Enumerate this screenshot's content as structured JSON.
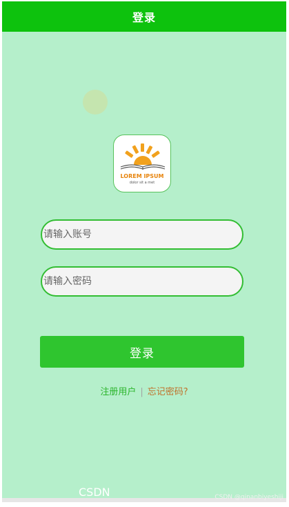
{
  "header": {
    "title": "登录"
  },
  "logo": {
    "text_main": "LOREM IPSUM",
    "text_sub": "dolor sit a met"
  },
  "form": {
    "username_placeholder": "请输入账号",
    "password_placeholder": "请输入密码",
    "login_button_label": "登录"
  },
  "links": {
    "register": "注册用户",
    "separator": "|",
    "forgot": "忘记密码?"
  },
  "watermark": {
    "brand": "CSDN",
    "user": "CSDN @qinanbiyeshiji"
  },
  "colors": {
    "header_bg": "#0dc20d",
    "page_bg": "#b5efcb",
    "button_bg": "#2fc52f",
    "field_border": "#32bd32",
    "register_link": "#2bb52b",
    "forgot_link": "#c0702a"
  }
}
